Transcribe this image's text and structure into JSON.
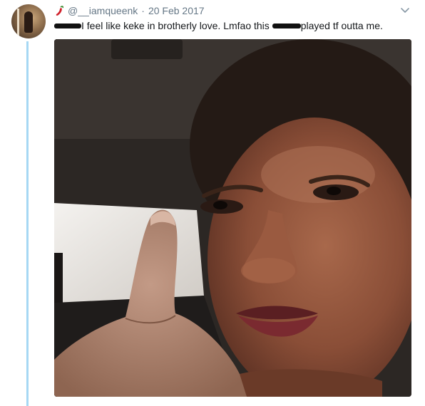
{
  "tweet": {
    "emoji_icon": "chili-pepper-icon",
    "handle": "@__iamqueenk",
    "separator": "·",
    "date": "20 Feb 2017",
    "text_part1": "I feel like keke in brotherly love. Lmfao this",
    "text_part2": "played tf outta me.",
    "menu_icon": "chevron-down-icon",
    "photo_description_icon": "selfie-photo"
  },
  "colors": {
    "thread_line": "#a6d8f4",
    "meta_text": "#657786",
    "body_text": "#14171a"
  }
}
